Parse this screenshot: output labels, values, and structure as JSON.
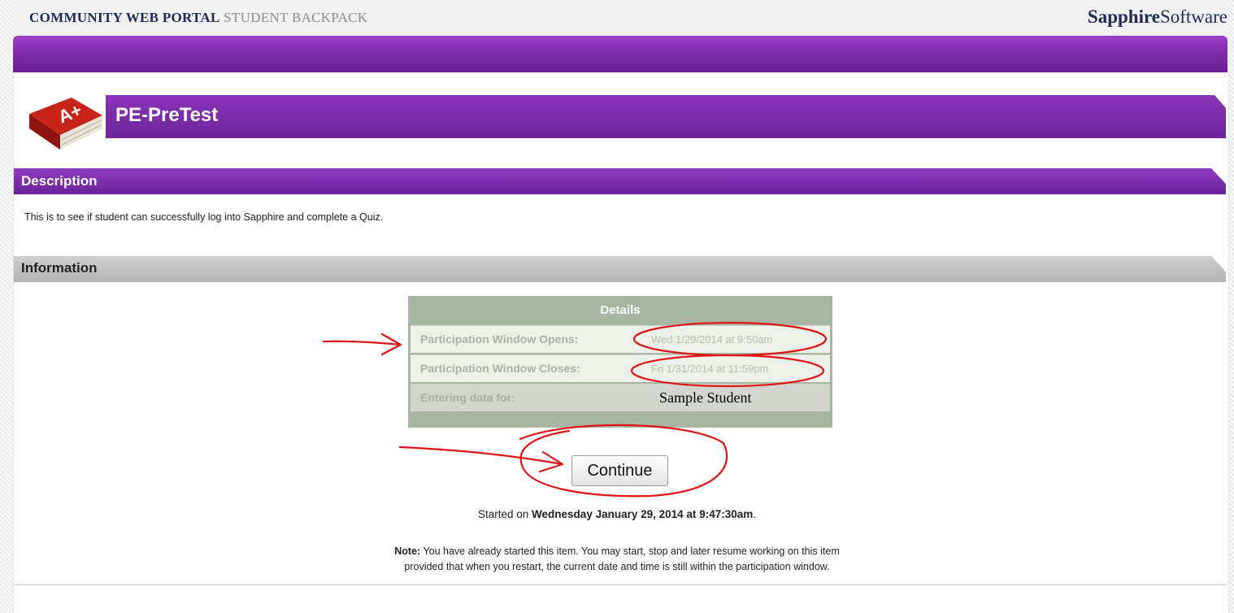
{
  "header": {
    "portal_name": "COMMUNITY WEB PORTAL",
    "portal_section": "STUDENT BACKPACK",
    "brand_bold": "Sapphire",
    "brand_regular": "Software"
  },
  "quiz": {
    "title": "PE-PreTest",
    "icon": "a-plus-book-icon"
  },
  "description": {
    "label": "Description",
    "text": "This is to see if student can successfully log into Sapphire and complete a Quiz."
  },
  "information": {
    "label": "Information",
    "details_heading": "Details",
    "rows": [
      {
        "label": "Participation Window Opens:",
        "value": "Wed 1/29/2014 at 9:50am"
      },
      {
        "label": "Participation Window Closes:",
        "value": "Fri 1/31/2014 at 11:59pm"
      },
      {
        "label": "Entering data for:",
        "value": "Sample Student"
      }
    ]
  },
  "continue_label": "Continue",
  "started": {
    "prefix": "Started on",
    "date": "Wednesday January 29, 2014",
    "at": "at",
    "time": "9:47:30am",
    "suffix": "."
  },
  "note": {
    "label": "Note:",
    "line1": "You have already started this item.  You may start, stop and later resume working on this item",
    "line2": "provided that when you restart, the current date and time is still within the participation window."
  },
  "colors": {
    "purple": "#7a2aa6",
    "info_gray": "#b3b3b3",
    "table_green": "#a8b5a2",
    "annotation_red": "#e01414"
  }
}
